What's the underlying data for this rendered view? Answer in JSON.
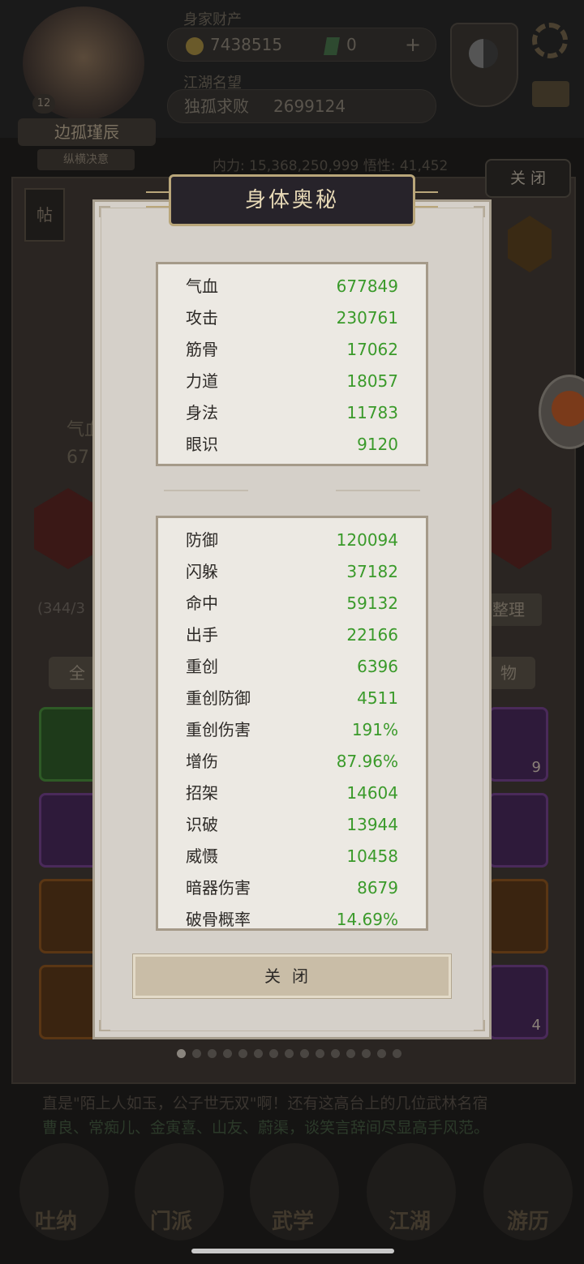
{
  "header": {
    "wealth_label": "身家财产",
    "coins": "7438515",
    "jade": "0",
    "plus": "+",
    "fame_label": "江湖名望",
    "fame_title": "独孤求败",
    "fame_value": "2699124",
    "player_name": "边孤瑾辰",
    "player_sect": "纵横决意",
    "level": "12",
    "power_line": "内力: 15,368,250,999  悟性: 41,452",
    "close_label": "关 闭"
  },
  "background": {
    "tie_label": "帖",
    "qixue_partial": "气血",
    "qixue_num_partial": "67",
    "bag_count_partial": "(344/3",
    "sort_label": "整理",
    "tab_all": "全",
    "tab_item": "物",
    "slot_count_1": "9",
    "slot_count_2": "4",
    "story_line_1": "直是\"陌上人如玉，公子世无双\"啊！还有这高台上的几位武林名宿",
    "story_line_2": "曹良、常痴儿、金寅喜、山友、蔚渠，谈笑言辞间尽显高手风范。",
    "nav": [
      "吐纳",
      "门派",
      "武学",
      "江湖",
      "游历"
    ]
  },
  "popup": {
    "title": "身体奥秘",
    "base_stats": [
      {
        "label": "气血",
        "value": "677849"
      },
      {
        "label": "攻击",
        "value": "230761"
      },
      {
        "label": "筋骨",
        "value": "17062"
      },
      {
        "label": "力道",
        "value": "18057"
      },
      {
        "label": "身法",
        "value": "11783"
      },
      {
        "label": "眼识",
        "value": "9120"
      }
    ],
    "adv_stats": [
      {
        "label": "防御",
        "value": "120094"
      },
      {
        "label": "闪躲",
        "value": "37182"
      },
      {
        "label": "命中",
        "value": "59132"
      },
      {
        "label": "出手",
        "value": "22166"
      },
      {
        "label": "重创",
        "value": "6396"
      },
      {
        "label": "重创防御",
        "value": "4511"
      },
      {
        "label": "重创伤害",
        "value": "191%"
      },
      {
        "label": "增伤",
        "value": "87.96%"
      },
      {
        "label": "招架",
        "value": "14604"
      },
      {
        "label": "识破",
        "value": "13944"
      },
      {
        "label": "威慑",
        "value": "10458"
      },
      {
        "label": "暗器伤害",
        "value": "8679"
      },
      {
        "label": "破骨概率",
        "value": "14.69%"
      }
    ],
    "close_label": "关闭",
    "page_dots_total": 15,
    "page_dots_active": 0
  },
  "colors": {
    "stat_value": "#3a9a2a",
    "title_text": "#e7d9b6",
    "popup_bg": "#d5d0c9"
  }
}
